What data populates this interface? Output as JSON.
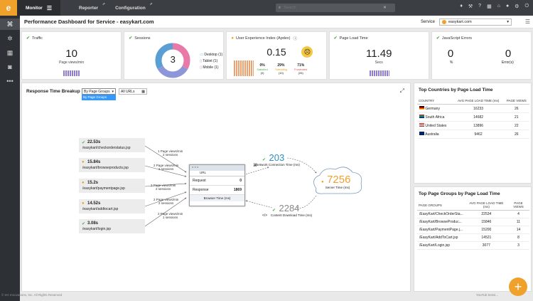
{
  "topbar": {
    "tabs": [
      "Monitor",
      "Reporter",
      "Configuration"
    ],
    "search_placeholder": "Search"
  },
  "title": "Performance Dashboard for Service - easykart.com",
  "service": {
    "label": "Service",
    "value": "easykart.com"
  },
  "cards": {
    "traffic": {
      "title": "Traffic",
      "value": "10",
      "unit": "Page views/min"
    },
    "sessions": {
      "title": "Sessions",
      "value": "3",
      "legend": [
        {
          "name": "Desktop",
          "count": "(1)"
        },
        {
          "name": "Tablet",
          "count": "(1)"
        },
        {
          "name": "Mobile",
          "count": "(1)"
        }
      ]
    },
    "apdex": {
      "title": "User Experience Index (Apdex)",
      "value": "0.15",
      "stats": [
        {
          "pct": "0%",
          "label": "Satisfied",
          "n": "(0)"
        },
        {
          "pct": "29%",
          "label": "Tolerating",
          "n": "(10)"
        },
        {
          "pct": "71%",
          "label": "Frustrated",
          "n": "(26)"
        }
      ]
    },
    "plt": {
      "title": "Page Load Time",
      "value": "11.49",
      "unit": "Secs"
    },
    "js": {
      "title": "JavaScript Errors",
      "v1": "0",
      "u1": "%",
      "v2": "0",
      "u2": "Error(s)"
    }
  },
  "breakup": {
    "title": "Response Time Breakup",
    "group_select": "By Page Groups",
    "group_option": "By Page Groups",
    "url_select": "All URLs",
    "pages": [
      {
        "time": "22.53s",
        "url": "/easykart/checkorderstatus.jsp",
        "rate": "1 Page views/min",
        "sess": "2 sessions",
        "status": "ok"
      },
      {
        "time": "15.84s",
        "url": "/easykart/browseproducts.jsp",
        "rate": "2 Page views/min",
        "sess": "2 sessions",
        "status": "warn"
      },
      {
        "time": "15.2s",
        "url": "/easykart/paymentpage.jsp",
        "rate": "3 Page views/min",
        "sess": "2 sessions",
        "status": "warn"
      },
      {
        "time": "14.52s",
        "url": "/easykart/addtocart.jsp",
        "rate": "2 Page views/min",
        "sess": "2 sessions",
        "status": "warn"
      },
      {
        "time": "3.08s",
        "url": "/easykart/login.jsp",
        "rate": "2 Page views/min",
        "sess": "1 sessions",
        "status": "ok"
      }
    ],
    "browser": {
      "url": "URL",
      "request_label": "Request",
      "request": "0",
      "response_label": "Response",
      "response": "1869",
      "footer": "Browser Time (ms)"
    },
    "network": {
      "value": "203",
      "label": "Network Connection Time (ms)"
    },
    "server": {
      "value": "7256",
      "label": "Server Time (ms)"
    },
    "download": {
      "value": "2284",
      "label": "Content Download Time (ms)"
    }
  },
  "countries": {
    "title": "Top Countries by Page Load Time",
    "headers": [
      "COUNTRY",
      "AVG PAGE LOAD TIME (ms)",
      "PAGE VIEWS"
    ],
    "rows": [
      [
        "Germany",
        "16233",
        "26"
      ],
      [
        "South Africa",
        "14682",
        "21"
      ],
      [
        "United States",
        "13896",
        "22"
      ],
      [
        "Australia",
        "9462",
        "26"
      ]
    ]
  },
  "groups": {
    "title": "Top Page Groups by Page Load Time",
    "headers": [
      "PAGE GROUPS",
      "AVG PAGE LOAD TIME (ms)",
      "PAGE VIEWS"
    ],
    "rows": [
      [
        "/EasyKart/CheckOrderSta...",
        "22534",
        "4"
      ],
      [
        "/EasyKart/BrowseProduc...",
        "15846",
        "11"
      ],
      [
        "/EasyKart/PaymentPage.j...",
        "15200",
        "14"
      ],
      [
        "/EasyKart/AddToCart.jsp",
        "14521",
        "8"
      ],
      [
        "/EasyKart/Login.jsp",
        "3077",
        "3"
      ]
    ]
  },
  "footer": "© eG Innovations, Inc. All Rights Reserved",
  "footer_right": "YouTub Sessi..."
}
